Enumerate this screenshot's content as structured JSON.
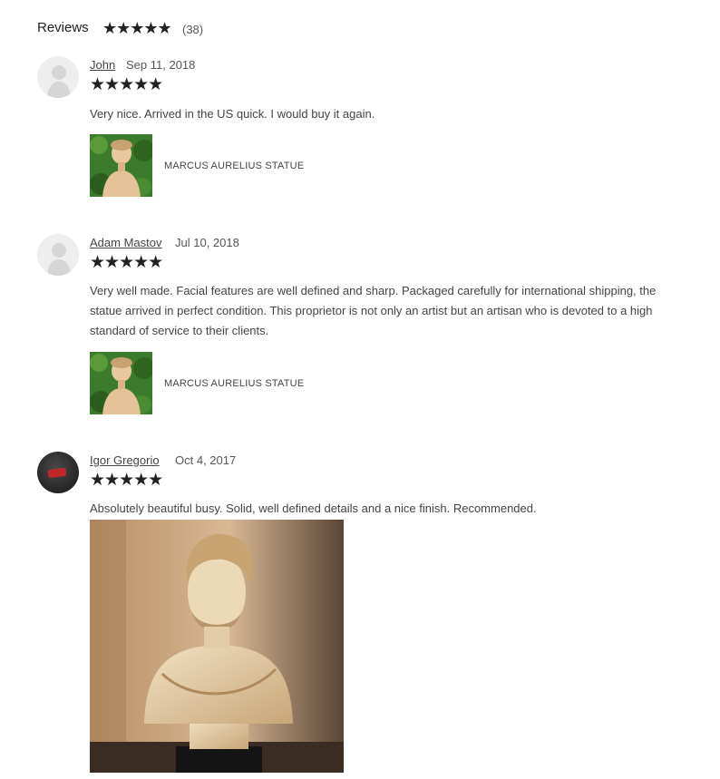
{
  "reviews_header": {
    "title": "Reviews",
    "stars": "★★★★★",
    "count": "(38)"
  },
  "reviews": [
    {
      "author": "John",
      "date": "Sep 11, 2018",
      "rating_stars": "★★★★★",
      "rating": 5,
      "text": "Very nice. Arrived in the US quick. I would buy it again.",
      "item_title": "MARCUS AURELIUS STATUE",
      "avatar": "default-user-icon"
    },
    {
      "author": "Adam Mastov",
      "date": "Jul 10, 2018",
      "rating_stars": "★★★★★",
      "rating": 5,
      "text": "Very well made. Facial features are well defined and sharp. Packaged carefully for international shipping, the statue arrived in perfect condition. This proprietor is not only an artist but an artisan who is devoted to a high standard of service to their clients.",
      "item_title": "MARCUS AURELIUS STATUE",
      "avatar": "default-user-icon"
    },
    {
      "author": "Igor Gregorio",
      "date": "Oct 4, 2017",
      "rating_stars": "★★★★★",
      "rating": 5,
      "text": "Absolutely beautiful busy. Solid, well defined details and a nice finish. Recommended.",
      "avatar": "custom-avatar"
    }
  ],
  "colors": {
    "star": "#222222",
    "text": "#444444",
    "thumb_background": "#3e7a2e"
  }
}
